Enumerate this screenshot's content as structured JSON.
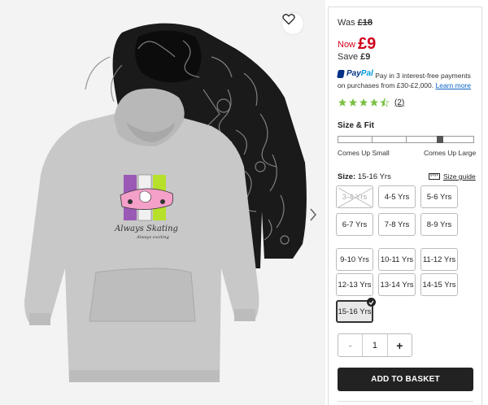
{
  "gallery": {
    "print_text_main": "Always Skating",
    "print_text_sub": "Always exciting",
    "wishlist_icon": "heart-outline-icon",
    "next_icon": "chevron-right-icon"
  },
  "price": {
    "was_label": "Was",
    "was_value": "£18",
    "now_label": "Now",
    "now_value": "£9",
    "save_label": "Save",
    "save_value": "£9",
    "sale_color": "#d0021b"
  },
  "paypal": {
    "logo_pay": "Pay",
    "logo_pal": "Pal",
    "text": "Pay in 3 interest-free payments on purchases from £30-£2,000.",
    "link": "Learn more"
  },
  "rating": {
    "stars": 4.5,
    "count": "(2)"
  },
  "fit": {
    "title": "Size & Fit",
    "left_label": "Comes Up Small",
    "right_label": "Comes Up Large",
    "position": 0.75
  },
  "size": {
    "label": "Size:",
    "selected": "15-16 Yrs",
    "guide": "Size guide",
    "options": [
      {
        "label": "3-4 Yrs",
        "available": false
      },
      {
        "label": "4-5 Yrs",
        "available": true
      },
      {
        "label": "5-6 Yrs",
        "available": true
      },
      {
        "label": "6-7 Yrs",
        "available": true
      },
      {
        "label": "7-8 Yrs",
        "available": true
      },
      {
        "label": "8-9 Yrs",
        "available": true
      },
      {
        "label": "9-10 Yrs",
        "available": true
      },
      {
        "label": "10-11 Yrs",
        "available": true
      },
      {
        "label": "11-12 Yrs",
        "available": true
      },
      {
        "label": "12-13 Yrs",
        "available": true
      },
      {
        "label": "13-14 Yrs",
        "available": true
      },
      {
        "label": "14-15 Yrs",
        "available": true
      },
      {
        "label": "15-16 Yrs",
        "available": true,
        "selected": true
      }
    ]
  },
  "quantity": {
    "minus": "-",
    "value": "1",
    "plus": "+"
  },
  "basket": {
    "label": "ADD TO BASKET"
  }
}
